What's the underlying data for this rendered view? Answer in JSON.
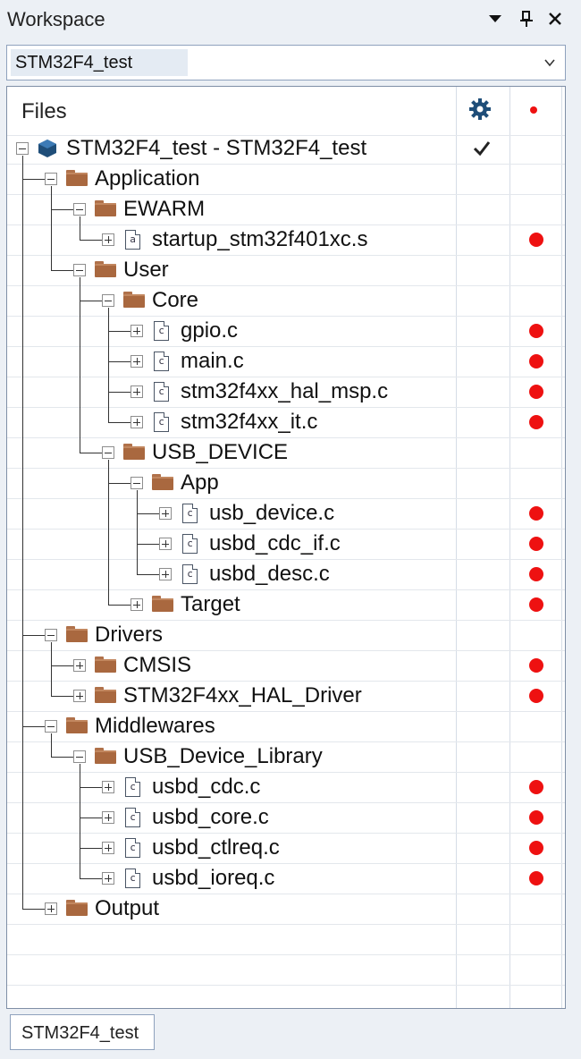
{
  "window": {
    "title": "Workspace",
    "controls": [
      {
        "name": "dropdown-arrow-icon",
        "glyph": "▼"
      },
      {
        "name": "pin-icon",
        "glyph": "📌"
      },
      {
        "name": "close-icon",
        "glyph": "✕"
      }
    ]
  },
  "configuration": {
    "value": "STM32F4_test"
  },
  "columns": {
    "files": "Files",
    "settings_icon": "gear-icon",
    "status_icon": "red-dot-icon"
  },
  "tree": [
    {
      "label": "STM32F4_test - STM32F4_test",
      "kind": "project",
      "expanded": true,
      "level": 0,
      "checked": true,
      "dot": false
    },
    {
      "label": "Application",
      "kind": "folder",
      "expanded": true,
      "level": 1,
      "dot": false
    },
    {
      "label": "EWARM",
      "kind": "folder",
      "expanded": true,
      "level": 2,
      "dot": false
    },
    {
      "label": "startup_stm32f401xc.s",
      "kind": "asm",
      "expanded": false,
      "level": 3,
      "dot": true
    },
    {
      "label": "User",
      "kind": "folder",
      "expanded": true,
      "level": 2,
      "dot": false
    },
    {
      "label": "Core",
      "kind": "folder",
      "expanded": true,
      "level": 3,
      "dot": false
    },
    {
      "label": "gpio.c",
      "kind": "c",
      "expanded": false,
      "level": 4,
      "dot": true
    },
    {
      "label": "main.c",
      "kind": "c",
      "expanded": false,
      "level": 4,
      "dot": true
    },
    {
      "label": "stm32f4xx_hal_msp.c",
      "kind": "c",
      "expanded": false,
      "level": 4,
      "dot": true
    },
    {
      "label": "stm32f4xx_it.c",
      "kind": "c",
      "expanded": false,
      "level": 4,
      "dot": true
    },
    {
      "label": "USB_DEVICE",
      "kind": "folder",
      "expanded": true,
      "level": 3,
      "dot": false
    },
    {
      "label": "App",
      "kind": "folder",
      "expanded": true,
      "level": 4,
      "dot": false
    },
    {
      "label": "usb_device.c",
      "kind": "c",
      "expanded": false,
      "level": 5,
      "dot": true
    },
    {
      "label": "usbd_cdc_if.c",
      "kind": "c",
      "expanded": false,
      "level": 5,
      "dot": true
    },
    {
      "label": "usbd_desc.c",
      "kind": "c",
      "expanded": false,
      "level": 5,
      "dot": true
    },
    {
      "label": "Target",
      "kind": "folder",
      "expanded": false,
      "level": 4,
      "dot": true
    },
    {
      "label": "Drivers",
      "kind": "folder",
      "expanded": true,
      "level": 1,
      "dot": false
    },
    {
      "label": "CMSIS",
      "kind": "folder",
      "expanded": false,
      "level": 2,
      "dot": true
    },
    {
      "label": "STM32F4xx_HAL_Driver",
      "kind": "folder",
      "expanded": false,
      "level": 2,
      "dot": true
    },
    {
      "label": "Middlewares",
      "kind": "folder",
      "expanded": true,
      "level": 1,
      "dot": false
    },
    {
      "label": "USB_Device_Library",
      "kind": "folder",
      "expanded": true,
      "level": 2,
      "dot": false
    },
    {
      "label": "usbd_cdc.c",
      "kind": "c",
      "expanded": false,
      "level": 3,
      "dot": true
    },
    {
      "label": "usbd_core.c",
      "kind": "c",
      "expanded": false,
      "level": 3,
      "dot": true
    },
    {
      "label": "usbd_ctlreq.c",
      "kind": "c",
      "expanded": false,
      "level": 3,
      "dot": true
    },
    {
      "label": "usbd_ioreq.c",
      "kind": "c",
      "expanded": false,
      "level": 3,
      "dot": true
    },
    {
      "label": "Output",
      "kind": "folder",
      "expanded": false,
      "level": 1,
      "dot": false
    }
  ],
  "bottom_tab": {
    "label": "STM32F4_test"
  },
  "colors": {
    "dot": "#ee1111",
    "folder": "#a9683f",
    "project_cube": "#1f4e79",
    "gear": "#1f4e79"
  }
}
